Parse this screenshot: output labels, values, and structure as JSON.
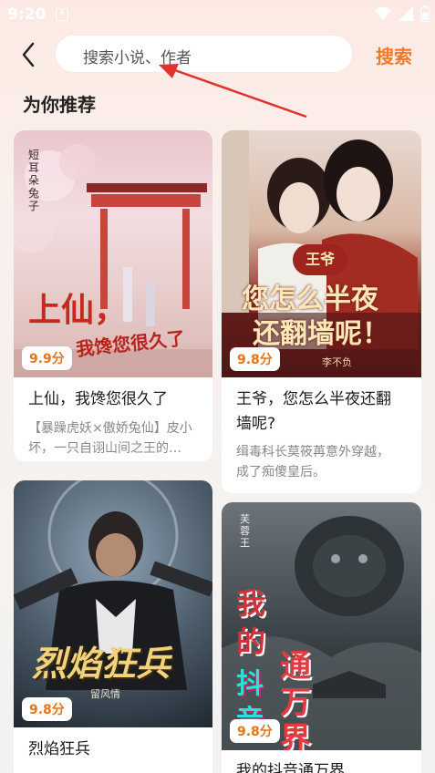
{
  "status": {
    "time": "9:20",
    "notif_letter": "A"
  },
  "search": {
    "placeholder": "搜索小说、作者",
    "button_label": "搜索"
  },
  "section": {
    "title": "为你推荐"
  },
  "books": [
    {
      "cover_title": "上仙，",
      "cover_subtitle": "我馋您很久了",
      "cover_author": "短耳朵兔子",
      "rating": "9.9分",
      "title": "上仙，我馋您很久了",
      "desc_line1": "【暴躁虎妖×傲娇兔仙】皮小",
      "desc_line2": "坏，一只自诩山间之王的…"
    },
    {
      "cover_badge": "王爷",
      "cover_title": "您怎么半夜",
      "cover_subtitle": "还翻墙呢！",
      "cover_author": "李不负",
      "rating": "9.8分",
      "title_line1": "王爷，您怎么半夜还翻",
      "title_line2": "墙呢?",
      "desc_line1": "缉毒科长莫筱苒意外穿越，",
      "desc_line2": "成了痴傻皇后。"
    },
    {
      "cover_title": "烈焰狂兵",
      "cover_author": "留风情",
      "rating": "9.8分",
      "title": "烈焰狂兵"
    },
    {
      "cover_title_a": "我的",
      "cover_title_b": "通万界",
      "cover_title_c": "抖音",
      "cover_author": "芙蓉王",
      "rating": "9.8分",
      "title": "我的抖音通万界"
    }
  ],
  "colors": {
    "accent": "#f47a2a",
    "rating": "#e8741a",
    "arrow": "#e0322e"
  }
}
